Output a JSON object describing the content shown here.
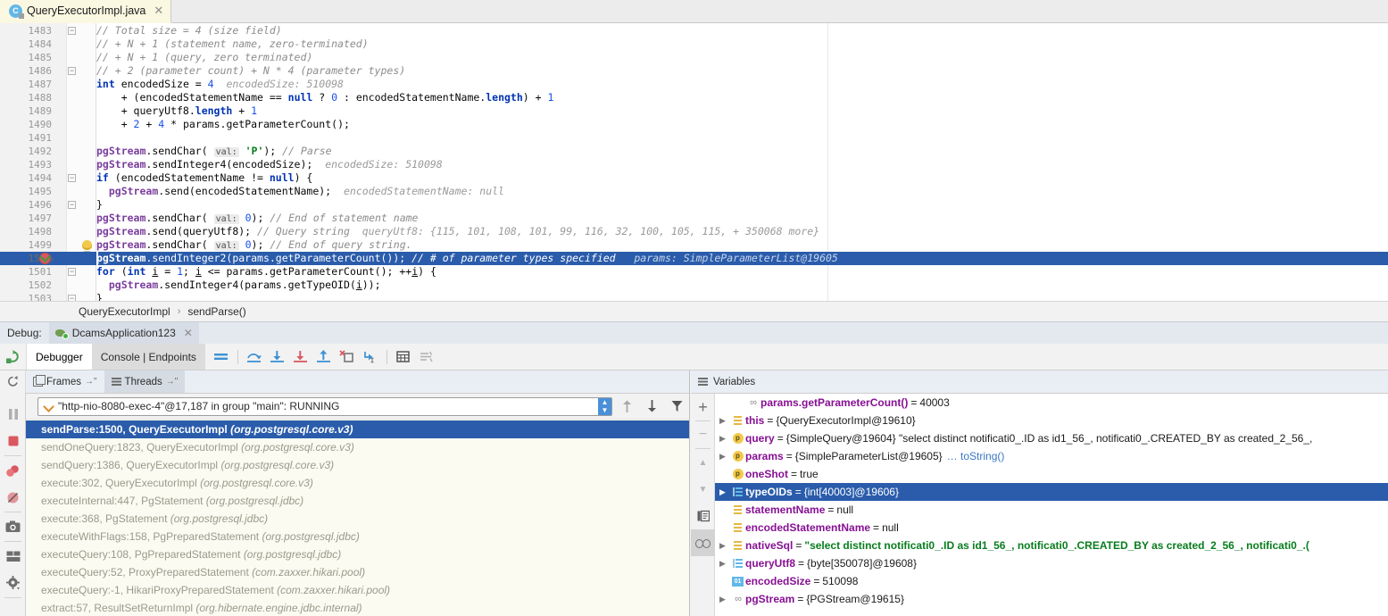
{
  "editor_tab": {
    "filename": "QueryExecutorImpl.java",
    "icon": "java-class-icon",
    "close_icon": "close-icon"
  },
  "code": {
    "lines": [
      {
        "num": "1483",
        "html": "<span class=\"cmt\">// Total size = 4 (size field)</span>",
        "fold": "collapse",
        "state": "normal"
      },
      {
        "num": "1484",
        "html": "<span class=\"cmt\">// + N + 1 (statement name, zero-terminated)</span>",
        "state": "normal"
      },
      {
        "num": "1485",
        "html": "<span class=\"cmt\">// + N + 1 (query, zero terminated)</span>",
        "state": "normal"
      },
      {
        "num": "1486",
        "html": "<span class=\"cmt\">// + 2 (parameter count) + N * 4 (parameter types)</span>",
        "fold": "end",
        "state": "normal"
      },
      {
        "num": "1487",
        "html": "<span class=\"kw\">int</span> encodedSize = <span class=\"num\">4</span>  <span class=\"hint\">encodedSize: 510098</span>",
        "state": "normal"
      },
      {
        "num": "1488",
        "html": "    + (encodedStatementName == <span class=\"kw\">null</span> ? <span class=\"num\">0</span> : encodedStatementName.<span class=\"kw\">length</span>) + <span class=\"num\">1</span>",
        "state": "normal"
      },
      {
        "num": "1489",
        "html": "    + queryUtf8.<span class=\"kw\">length</span> + <span class=\"num\">1</span>",
        "state": "normal"
      },
      {
        "num": "1490",
        "html": "    + <span class=\"num\">2</span> + <span class=\"num\">4</span> * params.getParameterCount();",
        "state": "normal"
      },
      {
        "num": "1491",
        "html": "",
        "state": "normal"
      },
      {
        "num": "1492",
        "html": "<span class=\"mth\">pgStream</span>.sendChar( <span class=\"valtag\">val:</span> <span class=\"str\">'P'</span>); <span class=\"cmt\">// Parse</span>",
        "state": "normal"
      },
      {
        "num": "1493",
        "html": "<span class=\"mth\">pgStream</span>.sendInteger4(encodedSize);  <span class=\"hint\">encodedSize: 510098</span>",
        "state": "normal"
      },
      {
        "num": "1494",
        "html": "<span class=\"kw\">if</span> (encodedStatementName != <span class=\"kw\">null</span>) {",
        "fold": "collapse",
        "state": "normal"
      },
      {
        "num": "1495",
        "html": "  <span class=\"mth\">pgStream</span>.send(encodedStatementName);  <span class=\"hint\">encodedStatementName: null</span>",
        "state": "normal"
      },
      {
        "num": "1496",
        "html": "}",
        "fold": "end",
        "state": "normal"
      },
      {
        "num": "1497",
        "html": "<span class=\"mth\">pgStream</span>.sendChar( <span class=\"valtag\">val:</span> <span class=\"num\">0</span>); <span class=\"cmt\">// End of statement name</span>",
        "state": "normal"
      },
      {
        "num": "1498",
        "html": "<span class=\"mth\">pgStream</span>.send(queryUtf8); <span class=\"cmt\">// Query string</span>  <span class=\"hint\">queryUtf8: {115, 101, 108, 101, 99, 116, 32, 100, 105, 115, + 350068 more}</span>",
        "state": "normal"
      },
      {
        "num": "1499",
        "html": "<span class=\"mth\">pgStream</span>.sendChar( <span class=\"valtag\">val:</span> <span class=\"num\">0</span>); <span class=\"cmt\">// End of query string.</span>",
        "bulb": true,
        "state": "normal"
      },
      {
        "num": "1500",
        "html": "<span class=\"mth\">pgStream</span>.sendInteger2(params.getParameterCount()); <span class=\"cmt\">// # of parameter types specified</span>   <span class=\"hint\">params: SimpleParameterList@19605</span>",
        "breakpoint": "hit-conditional",
        "state": "executing"
      },
      {
        "num": "1501",
        "html": "<span class=\"kw\">for</span> (<span class=\"kw\">int</span> <u>i</u> = <span class=\"num\">1</span>; <u>i</u> &lt;= params.getParameterCount(); ++<u>i</u>) {",
        "fold": "collapse",
        "state": "normal"
      },
      {
        "num": "1502",
        "html": "  <span class=\"mth\">pgStream</span>.sendInteger4(params.getTypeOID(<u>i</u>));",
        "state": "normal"
      },
      {
        "num": "1503",
        "html": "}",
        "fold": "end",
        "state": "normal"
      }
    ]
  },
  "breadcrumb": {
    "class_name": "QueryExecutorImpl",
    "separator": "›",
    "method_name": "sendParse()"
  },
  "debug_header": {
    "label": "Debug:",
    "session_name": "DcamsApplication123",
    "session_icon": "debug-bug-icon",
    "close_icon": "close-icon"
  },
  "tool_tabs": {
    "rerun_icon": "rerun-icon",
    "tabs": [
      {
        "label": "Debugger",
        "selected": true
      },
      {
        "label": "Console | Endpoints",
        "selected": false
      }
    ],
    "toolbar": [
      {
        "name": "mute-breakpoints-icon",
        "glyph": "≡"
      },
      {
        "name": "step-over-icon",
        "glyph": "⤴"
      },
      {
        "name": "step-into-icon",
        "glyph": "↓"
      },
      {
        "name": "force-step-into-icon",
        "glyph": "↓"
      },
      {
        "name": "step-out-icon",
        "glyph": "↑"
      },
      {
        "name": "drop-frame-icon",
        "glyph": "✕"
      },
      {
        "name": "run-to-cursor-icon",
        "glyph": "↘"
      },
      {
        "name": "evaluate-expression-icon",
        "glyph": "▦"
      },
      {
        "name": "settings-layout-icon",
        "glyph": "≣"
      }
    ]
  },
  "left_strip": [
    {
      "name": "resume-program-icon",
      "glyph": "▶"
    },
    {
      "name": "pause-program-icon",
      "glyph": "‖"
    },
    {
      "name": "stop-icon",
      "glyph": "■"
    },
    {
      "name": "view-breakpoints-icon",
      "glyph": "●"
    },
    {
      "name": "mute-breakpoints-strip-icon",
      "glyph": "⊘"
    },
    {
      "name": "screenshot-camera-icon",
      "glyph": "▣"
    },
    {
      "name": "layout-settings-icon",
      "glyph": "▤"
    },
    {
      "name": "settings-gear-icon",
      "glyph": "⚙"
    }
  ],
  "frames": {
    "header": {
      "refresh_icon": "refresh-icon",
      "tabs": [
        {
          "label": "Frames",
          "suffix": "→\"",
          "icon": "frames-icon",
          "selected": true
        },
        {
          "label": "Threads",
          "suffix": "→\"",
          "icon": "threads-icon",
          "selected": false
        }
      ]
    },
    "thread_selector": {
      "value": "\"http-nio-8080-exec-4\"@17,187 in group \"main\": RUNNING",
      "status_icon": "running-check-icon",
      "spinner_icon": "spinner-updown-icon",
      "buttons": [
        {
          "name": "move-up-icon",
          "glyph": "↑"
        },
        {
          "name": "move-down-icon",
          "glyph": "↓"
        },
        {
          "name": "filter-frames-icon",
          "glyph": "▼"
        }
      ]
    },
    "items": [
      {
        "method": "sendParse:1500, QueryExecutorImpl",
        "package": "(org.postgresql.core.v3)",
        "selected": true
      },
      {
        "method": "sendOneQuery:1823, QueryExecutorImpl",
        "package": "(org.postgresql.core.v3)",
        "selected": false
      },
      {
        "method": "sendQuery:1386, QueryExecutorImpl",
        "package": "(org.postgresql.core.v3)",
        "selected": false
      },
      {
        "method": "execute:302, QueryExecutorImpl",
        "package": "(org.postgresql.core.v3)",
        "selected": false
      },
      {
        "method": "executeInternal:447, PgStatement",
        "package": "(org.postgresql.jdbc)",
        "selected": false
      },
      {
        "method": "execute:368, PgStatement",
        "package": "(org.postgresql.jdbc)",
        "selected": false
      },
      {
        "method": "executeWithFlags:158, PgPreparedStatement",
        "package": "(org.postgresql.jdbc)",
        "selected": false
      },
      {
        "method": "executeQuery:108, PgPreparedStatement",
        "package": "(org.postgresql.jdbc)",
        "selected": false
      },
      {
        "method": "executeQuery:52, ProxyPreparedStatement",
        "package": "(com.zaxxer.hikari.pool)",
        "selected": false
      },
      {
        "method": "executeQuery:-1, HikariProxyPreparedStatement",
        "package": "(com.zaxxer.hikari.pool)",
        "selected": false
      },
      {
        "method": "extract:57, ResultSetReturnImpl",
        "package": "(org.hibernate.engine.jdbc.internal)",
        "selected": false
      }
    ]
  },
  "variables": {
    "header": {
      "title": "Variables",
      "icon": "variables-icon"
    },
    "strip": [
      {
        "name": "add-watch-icon",
        "glyph": "+"
      },
      {
        "name": "remove-watch-icon",
        "glyph": "−"
      },
      {
        "name": "move-watch-up-icon",
        "glyph": "▲"
      },
      {
        "name": "move-watch-down-icon",
        "glyph": "▼"
      },
      {
        "name": "copy-value-icon",
        "glyph": "❐"
      },
      {
        "name": "inspect-glasses-icon",
        "glyph": "∞"
      }
    ],
    "rows": [
      {
        "name": "params.getParameterCount()",
        "eq": "=",
        "value": "40003",
        "icon": "evaluate-icon",
        "twisty": "none",
        "indent": 1,
        "name_color": "#871094",
        "selected": false,
        "value_is_string": false
      },
      {
        "name": "this",
        "eq": "=",
        "value": "{QueryExecutorImpl@19610}",
        "icon": "field-icon",
        "twisty": "collapsed",
        "indent": 0,
        "selected": false,
        "value_is_string": false
      },
      {
        "name": "query",
        "eq": "=",
        "value": "{SimpleQuery@19604} \"select distinct notificati0_.ID as id1_56_, notificati0_.CREATED_BY as created_2_56_,",
        "icon": "parameter-icon",
        "twisty": "collapsed",
        "indent": 0,
        "selected": false,
        "value_is_string": false
      },
      {
        "name": "params",
        "eq": "=",
        "value": "{SimpleParameterList@19605}",
        "link": "… toString()",
        "icon": "parameter-icon",
        "twisty": "collapsed",
        "indent": 0,
        "selected": false,
        "value_is_string": false
      },
      {
        "name": "oneShot",
        "eq": "=",
        "value": "true",
        "icon": "parameter-icon",
        "twisty": "none",
        "indent": 0,
        "selected": false,
        "value_is_string": false
      },
      {
        "name": "typeOIDs",
        "eq": "=",
        "value": "{int[40003]@19606}",
        "icon": "array-icon",
        "twisty": "collapsed",
        "indent": 0,
        "selected": true,
        "value_is_string": false
      },
      {
        "name": "statementName",
        "eq": "=",
        "value": "null",
        "icon": "field-icon",
        "twisty": "none",
        "indent": 0,
        "selected": false,
        "value_is_string": false
      },
      {
        "name": "encodedStatementName",
        "eq": "=",
        "value": "null",
        "icon": "field-icon",
        "twisty": "none",
        "indent": 0,
        "selected": false,
        "value_is_string": false
      },
      {
        "name": "nativeSql",
        "eq": "=",
        "value": "\"select distinct notificati0_.ID as id1_56_, notificati0_.CREATED_BY as created_2_56_, notificati0_.(",
        "icon": "field-icon",
        "twisty": "collapsed",
        "indent": 0,
        "selected": false,
        "value_is_string": true
      },
      {
        "name": "queryUtf8",
        "eq": "=",
        "value": "{byte[350078]@19608}",
        "icon": "array-icon",
        "twisty": "collapsed",
        "indent": 0,
        "selected": false,
        "value_is_string": false
      },
      {
        "name": "encodedSize",
        "eq": "=",
        "value": "510098",
        "icon": "primitive-icon",
        "twisty": "none",
        "indent": 0,
        "selected": false,
        "value_is_string": false
      },
      {
        "name": "pgStream",
        "eq": "=",
        "value": "{PGStream@19615}",
        "icon": "evaluate-icon",
        "twisty": "collapsed",
        "indent": 0,
        "selected": false,
        "value_is_string": false
      }
    ]
  },
  "colors": {
    "selection_blue": "#2a5cab",
    "current_line": "#fbf8e2",
    "keyword": "#0033b3",
    "string": "#087d1e",
    "field_name": "#871094",
    "method": "#7a3e9d",
    "panel_header": "#e9eef4"
  }
}
